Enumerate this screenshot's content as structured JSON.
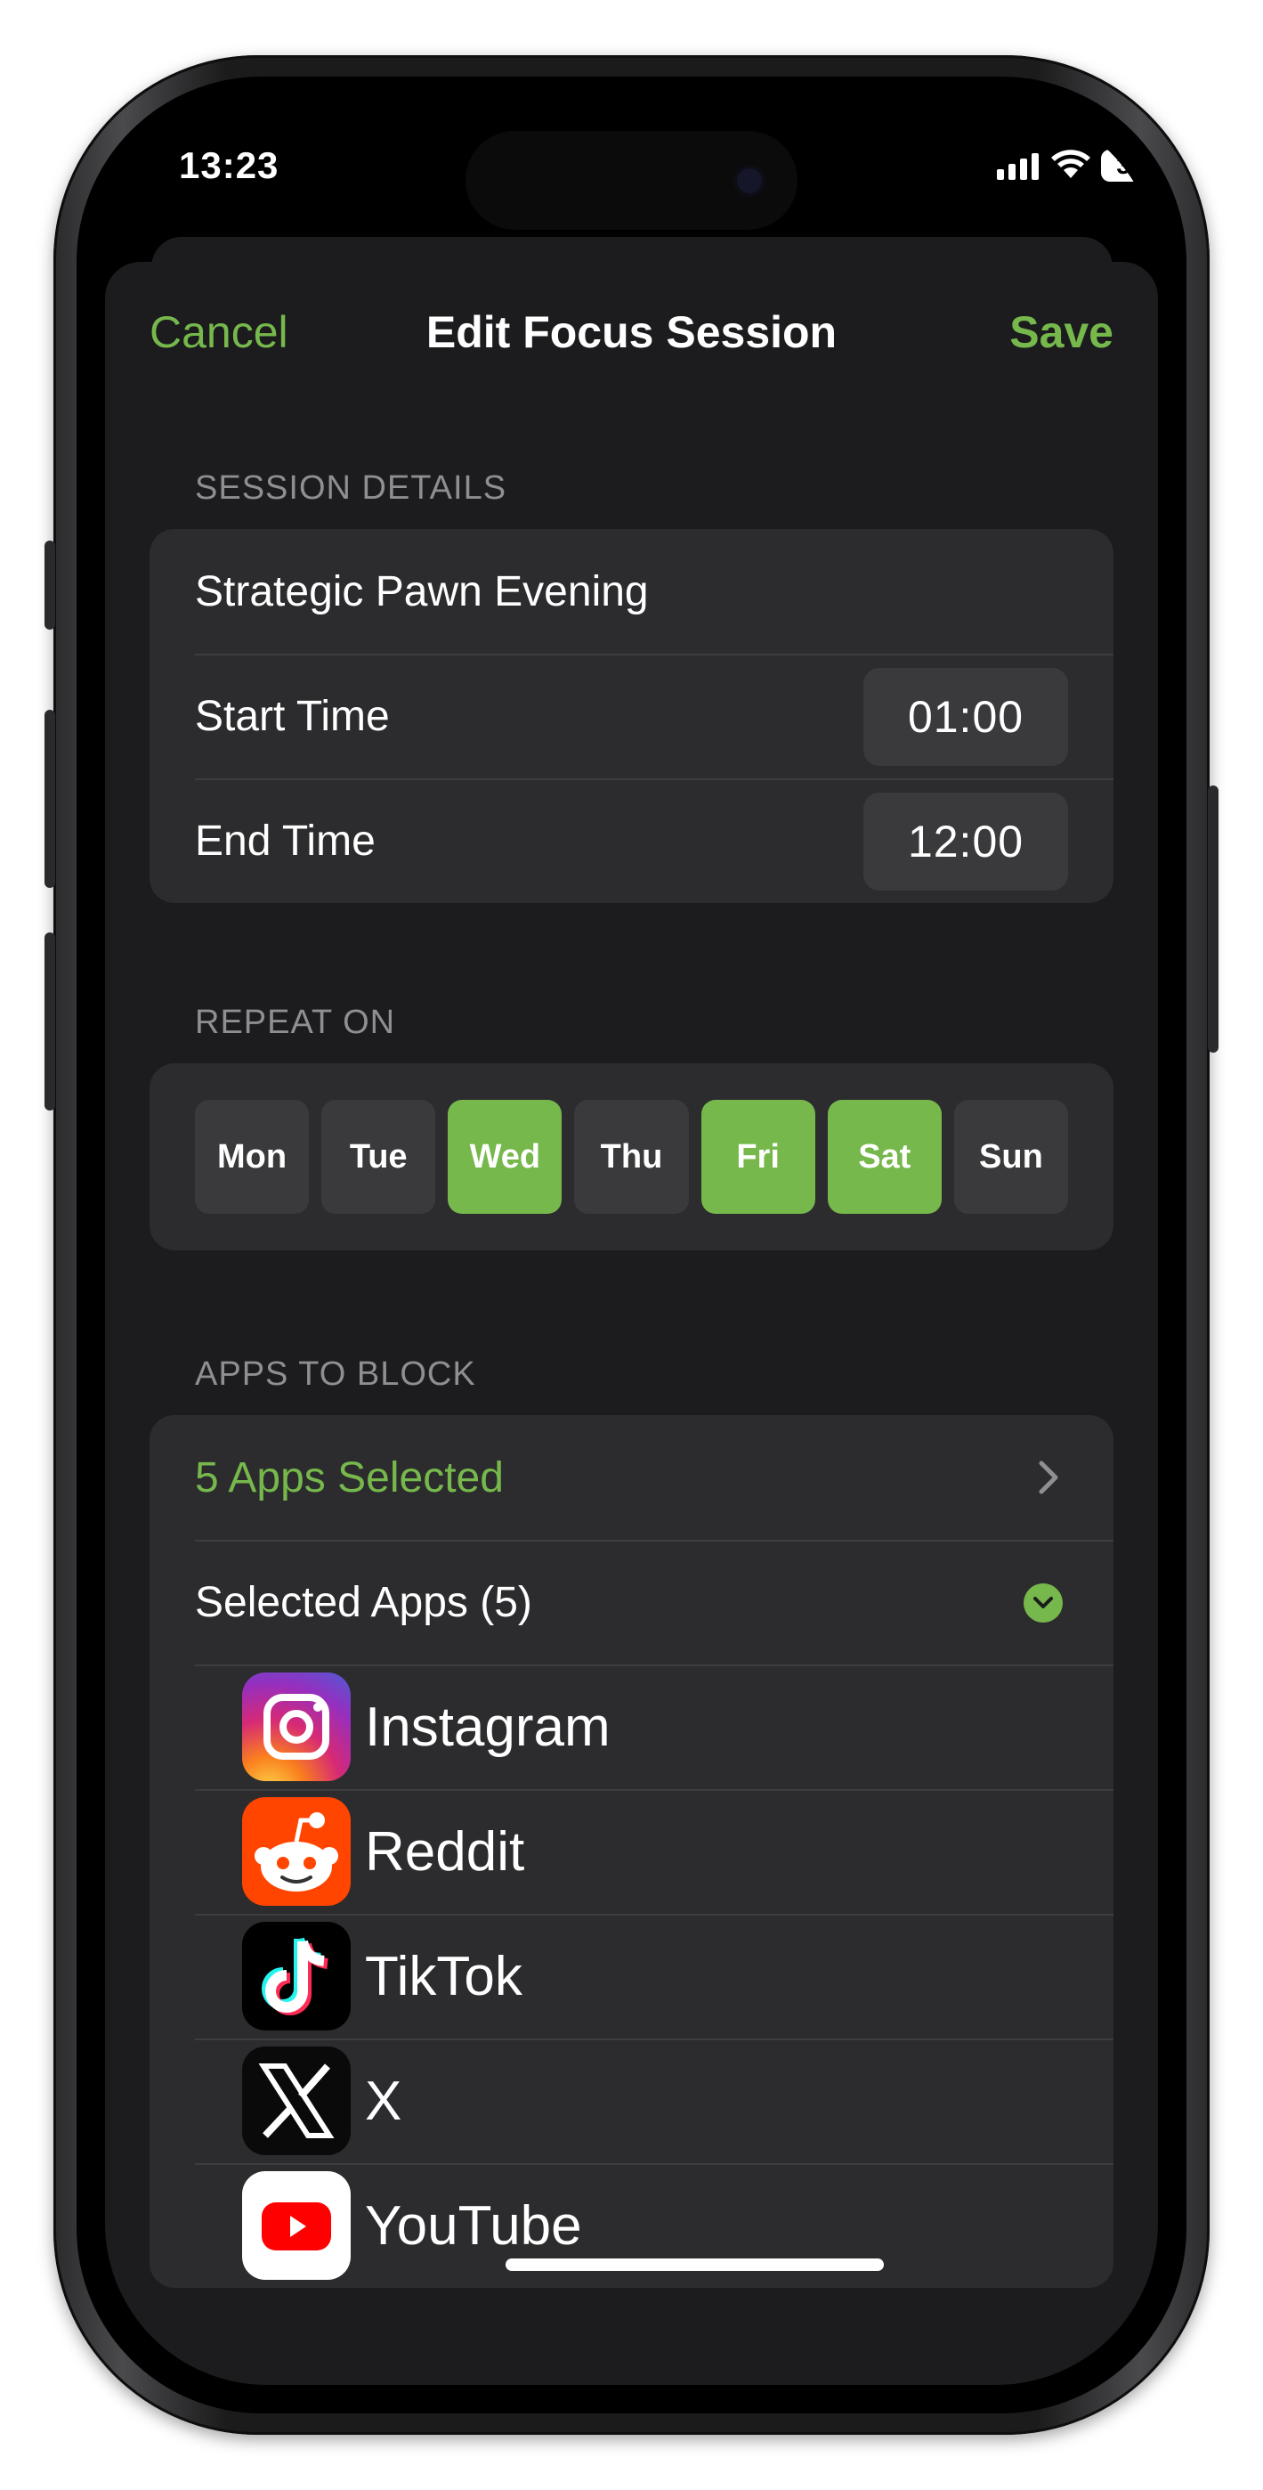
{
  "status_bar": {
    "time": "13:23",
    "battery": "35"
  },
  "nav": {
    "cancel": "Cancel",
    "title": "Edit Focus Session",
    "save": "Save"
  },
  "colors": {
    "accent": "#76b84c",
    "background": "#1c1c1e",
    "card": "#2c2c2e",
    "chip": "#3a3a3c"
  },
  "session_details": {
    "header": "SESSION DETAILS",
    "name": "Strategic Pawn Evening",
    "start_label": "Start Time",
    "start_value": "01:00",
    "end_label": "End Time",
    "end_value": "12:00"
  },
  "repeat": {
    "header": "REPEAT ON",
    "days": [
      {
        "label": "Mon",
        "selected": false
      },
      {
        "label": "Tue",
        "selected": false
      },
      {
        "label": "Wed",
        "selected": true
      },
      {
        "label": "Thu",
        "selected": false
      },
      {
        "label": "Fri",
        "selected": true
      },
      {
        "label": "Sat",
        "selected": true
      },
      {
        "label": "Sun",
        "selected": false
      }
    ]
  },
  "apps": {
    "header": "APPS TO BLOCK",
    "selected_label": "5 Apps Selected",
    "selected_apps_label": "Selected Apps (5)",
    "list": [
      {
        "name": "Instagram",
        "icon": "instagram-icon"
      },
      {
        "name": "Reddit",
        "icon": "reddit-icon"
      },
      {
        "name": "TikTok",
        "icon": "tiktok-icon"
      },
      {
        "name": "X",
        "icon": "x-icon"
      },
      {
        "name": "YouTube",
        "icon": "youtube-icon"
      }
    ]
  }
}
